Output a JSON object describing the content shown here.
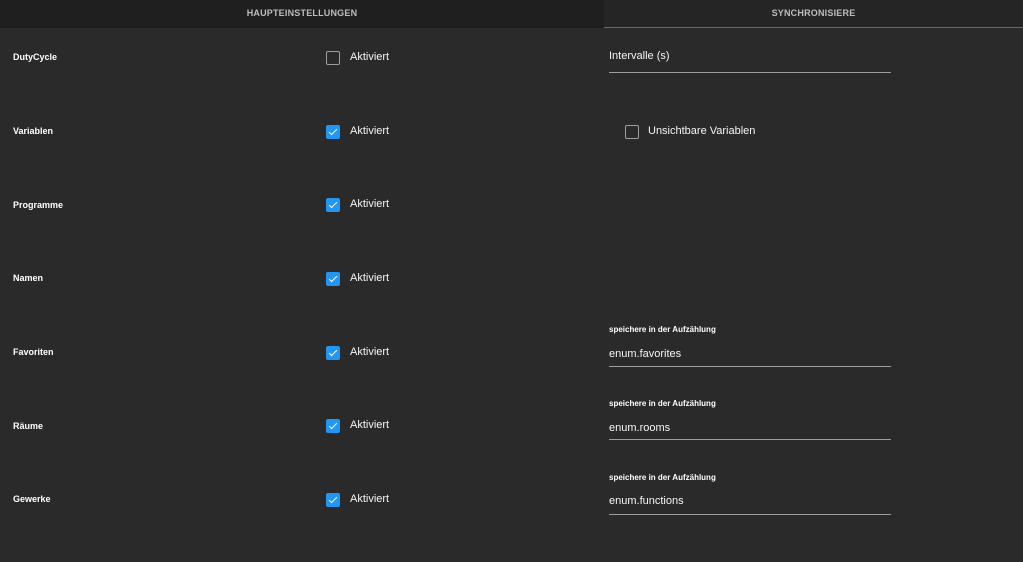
{
  "tabs": {
    "main": "HAUPTEINSTELLUNGEN",
    "sync": "SYNCHRONISIERE"
  },
  "rows": [
    {
      "label": "DutyCycle",
      "checkbox_label": "Aktiviert",
      "checked": false
    },
    {
      "label": "Variablen",
      "checkbox_label": "Aktiviert",
      "checked": true
    },
    {
      "label": "Programme",
      "checkbox_label": "Aktiviert",
      "checked": true
    },
    {
      "label": "Namen",
      "checkbox_label": "Aktiviert",
      "checked": true
    },
    {
      "label": "Favoriten",
      "checkbox_label": "Aktiviert",
      "checked": true
    },
    {
      "label": "Räume",
      "checkbox_label": "Aktiviert",
      "checked": true
    },
    {
      "label": "Gewerke",
      "checkbox_label": "Aktiviert",
      "checked": true
    }
  ],
  "interval": {
    "label": "Intervalle (s)",
    "value": ""
  },
  "invisible_variables": {
    "label": "Unsichtbare Variablen",
    "checked": false
  },
  "enum_fields": [
    {
      "label": "speichere in der Aufzählung",
      "value": "enum.favorites"
    },
    {
      "label": "speichere in der Aufzählung",
      "value": "enum.rooms"
    },
    {
      "label": "speichere in der Aufzählung",
      "value": "enum.functions"
    }
  ],
  "colors": {
    "background": "#2a2a2a",
    "accent": "#2196f3"
  }
}
